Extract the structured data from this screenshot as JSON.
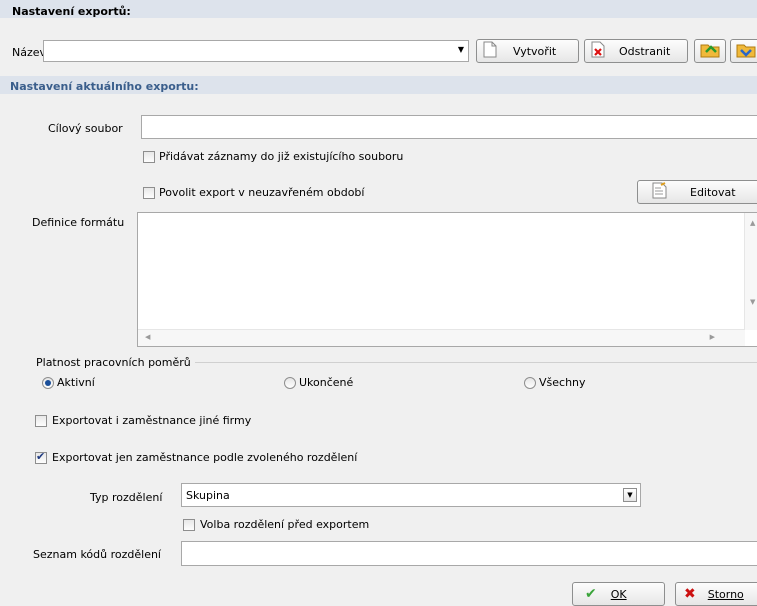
{
  "export_settings": {
    "header": "Nastavení exportů:",
    "name_label": "Název",
    "name_value": "",
    "create_label": "Vytvořit",
    "remove_label": "Odstranit"
  },
  "current_export": {
    "header": "Nastavení aktuálního exportu:",
    "target_file_label": "Cílový soubor",
    "target_file_value": "",
    "append_label": "Přidávat záznamy do již existujícího souboru",
    "append_checked": false,
    "allow_open_period_label": "Povolit export v neuzavřeném období",
    "allow_open_period_checked": false,
    "edit_label": "Editovat",
    "format_label": "Definice formátu",
    "format_value": ""
  },
  "validity": {
    "group_label": "Platnost pracovních poměrů",
    "options": [
      "Aktivní",
      "Ukončené",
      "Všechny"
    ],
    "selected": "Aktivní"
  },
  "other_company_label": "Exportovat i zaměstnance jiné firmy",
  "other_company_checked": false,
  "by_division_label": "Exportovat jen zaměstnance podle zvoleného rozdělení",
  "by_division_checked": true,
  "division_type_label": "Typ rozdělení",
  "division_type_value": "Skupina",
  "choose_before_export_label": "Volba rozdělení před exportem",
  "choose_before_export_checked": false,
  "code_list_label": "Seznam kódů rozdělení",
  "code_list_value": "",
  "ok_label": "OK",
  "cancel_label": "Storno",
  "colors": {
    "section_header": "#3a5e8c",
    "header_band": "#dde3ec",
    "cancel_icon": "#cc1111",
    "ok_icon": "#3aa43a"
  }
}
